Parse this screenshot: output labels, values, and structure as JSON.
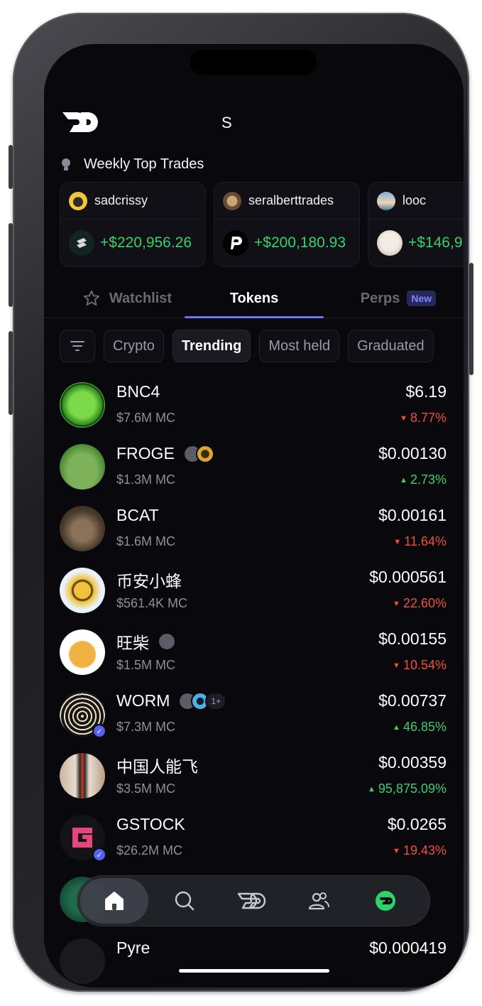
{
  "header": {
    "partial_text": "S"
  },
  "weekly": {
    "title": "Weekly Top Trades",
    "trades": [
      {
        "user": "sadcrissy",
        "pnl": "+$220,956.26",
        "coin_icon": "swap-coin-icon"
      },
      {
        "user": "seralberttrades",
        "pnl": "+$200,180.93",
        "coin_icon": "p-coin-icon"
      },
      {
        "user": "looc",
        "pnl": "+$146,9",
        "coin_icon": "avatar-coin-icon"
      }
    ]
  },
  "tabs": [
    {
      "label": "Watchlist",
      "icon": "star-icon"
    },
    {
      "label": "Tokens"
    },
    {
      "label": "Perps",
      "badge": "New"
    }
  ],
  "filters": [
    "Crypto",
    "Trending",
    "Most held",
    "Graduated"
  ],
  "tokens": [
    {
      "name": "BNC4",
      "mc": "$7.6M MC",
      "price": "$6.19",
      "change": "8.77%",
      "dir": "down"
    },
    {
      "name": "FROGE",
      "mc": "$1.3M MC",
      "price": "$0.00130",
      "change": "2.73%",
      "dir": "up"
    },
    {
      "name": "BCAT",
      "mc": "$1.6M MC",
      "price": "$0.00161",
      "change": "11.64%",
      "dir": "down"
    },
    {
      "name": "币安小蜂",
      "mc": "$561.4K MC",
      "price": "$0.000561",
      "change": "22.60%",
      "dir": "down"
    },
    {
      "name": "旺柴",
      "mc": "$1.5M MC",
      "price": "$0.00155",
      "change": "10.54%",
      "dir": "down"
    },
    {
      "name": "WORM",
      "mc": "$7.3M MC",
      "price": "$0.00737",
      "change": "46.85%",
      "dir": "up",
      "more_holders": "1+"
    },
    {
      "name": "中国人能飞",
      "mc": "$3.5M MC",
      "price": "$0.00359",
      "change": "95,875.09%",
      "dir": "up"
    },
    {
      "name": "GSTOCK",
      "mc": "$26.2M MC",
      "price": "$0.0265",
      "change": "19.43%",
      "dir": "down"
    },
    {
      "name": "",
      "mc": "",
      "price": "",
      "change": "",
      "dir": "down"
    },
    {
      "name": "Pyre",
      "mc": "",
      "price": "$0.000419",
      "change": "",
      "dir": "up"
    }
  ],
  "nav": [
    "home-icon",
    "search-icon",
    "logo-icon",
    "people-icon",
    "profile-icon"
  ],
  "colors": {
    "up": "#3bd16a",
    "down": "#f0513a",
    "accent": "#6d74f5"
  }
}
